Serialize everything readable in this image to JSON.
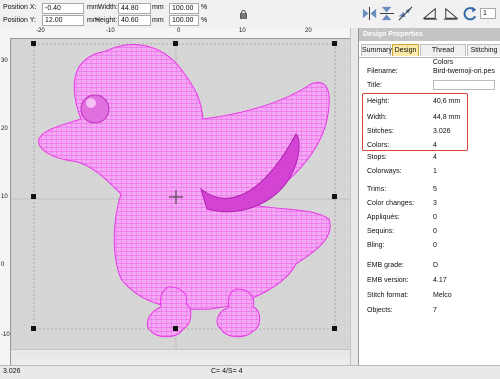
{
  "topbar": {
    "position_x_label": "Position X:",
    "position_x_value": "-0.40",
    "position_y_label": "Position Y:",
    "position_y_value": "12.00",
    "unit_mm": "mm",
    "width_label": "Width:",
    "width_value": "44.80",
    "height_label": "Height:",
    "height_value": "40.60",
    "width_pct": "100.00",
    "height_pct": "100.00",
    "unit_pct": "%"
  },
  "toolbar": {
    "icons": [
      "mirror-horizontal-icon",
      "mirror-vertical-icon",
      "mirror-diagonal-icon",
      "align-left-icon",
      "align-right-icon",
      "rotate-icon"
    ],
    "rotate_value": "1"
  },
  "rulers": {
    "top_ticks": [
      "-20",
      "-10",
      "0",
      "10",
      "20"
    ],
    "left_ticks": [
      "30",
      "20",
      "10",
      "0",
      "-10"
    ]
  },
  "panel": {
    "title": "Design Properties",
    "tabs": [
      "Summary",
      "Design",
      "Thread Colors",
      "Stitching"
    ],
    "active_tab": "Design",
    "rows": [
      {
        "label": "Filename:",
        "value": "Bird-twemoji-ori.pes"
      },
      {
        "label": "Title:",
        "value": ""
      },
      {
        "label": "Height:",
        "value": "40,6 mm"
      },
      {
        "label": "Width:",
        "value": "44,8 mm"
      },
      {
        "label": "Stitches:",
        "value": "3.026"
      },
      {
        "label": "Colors:",
        "value": "4"
      },
      {
        "label": "Stops:",
        "value": "4"
      },
      {
        "label": "Colorways:",
        "value": "1"
      },
      {
        "label": "Trims:",
        "value": "5"
      },
      {
        "label": "Color changes:",
        "value": "3"
      },
      {
        "label": "Appliqués:",
        "value": "0"
      },
      {
        "label": "Sequins:",
        "value": "0"
      },
      {
        "label": "Bling:",
        "value": "0"
      },
      {
        "label": "EMB grade:",
        "value": "D"
      },
      {
        "label": "EMB version:",
        "value": "4.17"
      },
      {
        "label": "Stitch format:",
        "value": "Melco"
      },
      {
        "label": "Objects:",
        "value": "7"
      }
    ]
  },
  "status": {
    "stitches": "3.026",
    "center": "C=  4/S=  4"
  },
  "colors": {
    "embroidery": "#ee33ee",
    "highlight": "#d9473a",
    "active_tab": "#fde9a8"
  }
}
